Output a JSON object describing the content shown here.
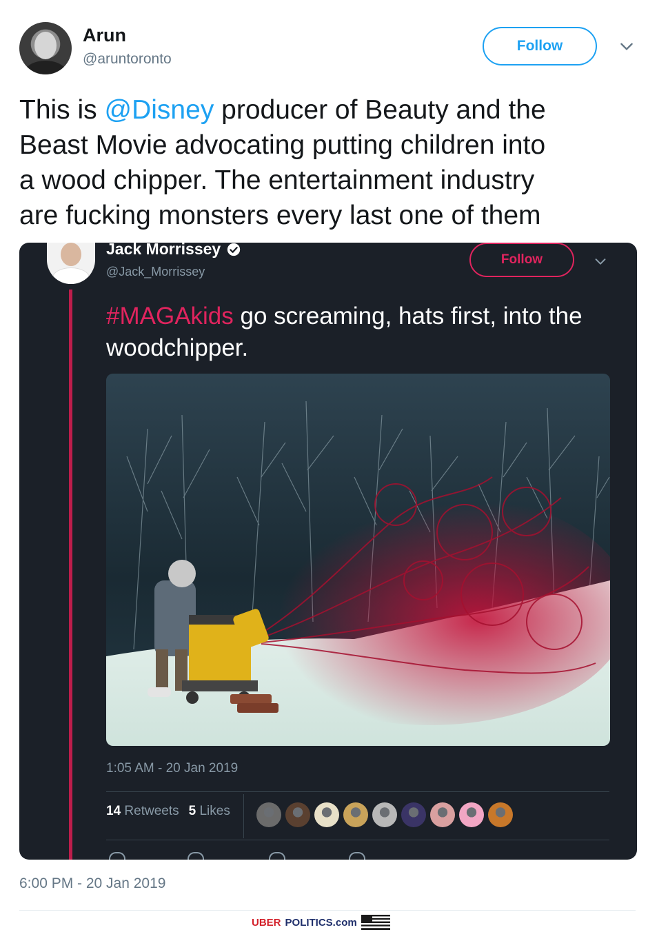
{
  "outer_tweet": {
    "author_name": "Arun",
    "author_handle": "@aruntoronto",
    "follow_label": "Follow",
    "text_parts": {
      "before": "This is ",
      "mention": "@Disney",
      "after": " producer of Beauty and the\nBeast Movie advocating putting children into\na wood chipper. The entertainment industry\nare fucking monsters every last one of them"
    },
    "timestamp": "6:00 PM - 20 Jan 2019",
    "icons": {
      "avatar": "avatar",
      "menu": "chevron-down-icon"
    }
  },
  "embedded_tweet": {
    "author_name": "Jack Morrissey",
    "author_handle": "@Jack_Morrissey",
    "verified": true,
    "follow_label": "Follow",
    "hashtag": "#MAGAkids",
    "text_after_hashtag": " go screaming, hats first, into the woodchipper.",
    "timestamp": "1:05 AM - 20 Jan 2019",
    "retweets_count": "14",
    "retweets_label": "Retweets",
    "likes_count": "5",
    "likes_label": "Likes",
    "liker_avatar_colors": [
      "#6b6b6b",
      "#5a4030",
      "#e8e0c8",
      "#c9a35a",
      "#b8b8b8",
      "#3a3466",
      "#d9a0a0",
      "#f2a6c4",
      "#c8782a"
    ],
    "icons": {
      "verified": "verified-badge-icon",
      "menu": "chevron-down-icon"
    },
    "colors": {
      "accent": "#e0245e",
      "background": "#1b2028"
    }
  },
  "footer": {
    "watermark_red": "UBER",
    "watermark_blue": "POLITICS.com",
    "flag_icon": "us-flag-icon"
  },
  "colors": {
    "twitter_blue": "#1da1f2",
    "muted": "#657786"
  }
}
